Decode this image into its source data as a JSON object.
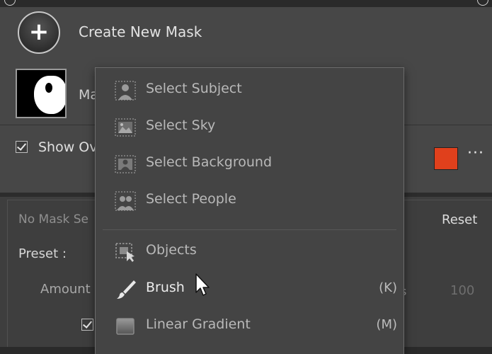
{
  "masks_panel": {
    "create_new_mask_label": "Create New Mask",
    "create_icon": "+",
    "mask_name_partial": "Ma",
    "show_overlay_label": "Show Ov",
    "show_overlay_checked": true,
    "overlay_color": "#e0401c",
    "more_icon": "···"
  },
  "adjust_panel": {
    "no_mask_label": "No Mask Se",
    "reset_label": "Reset",
    "preset_label": "Preset :",
    "amount_label": "Amount",
    "amount_value": "100",
    "amount_suffix": "s"
  },
  "menu": {
    "items": [
      {
        "label": "Select Subject",
        "icon": "select-subject-icon",
        "shortcut": ""
      },
      {
        "label": "Select Sky",
        "icon": "select-sky-icon",
        "shortcut": ""
      },
      {
        "label": "Select Background",
        "icon": "select-background-icon",
        "shortcut": ""
      },
      {
        "label": "Select People",
        "icon": "select-people-icon",
        "shortcut": ""
      },
      {
        "label": "Objects",
        "icon": "objects-icon",
        "shortcut": ""
      },
      {
        "label": "Brush",
        "icon": "brush-icon",
        "shortcut": "(K)"
      },
      {
        "label": "Linear Gradient",
        "icon": "linear-gradient-icon",
        "shortcut": "(M)"
      }
    ]
  }
}
